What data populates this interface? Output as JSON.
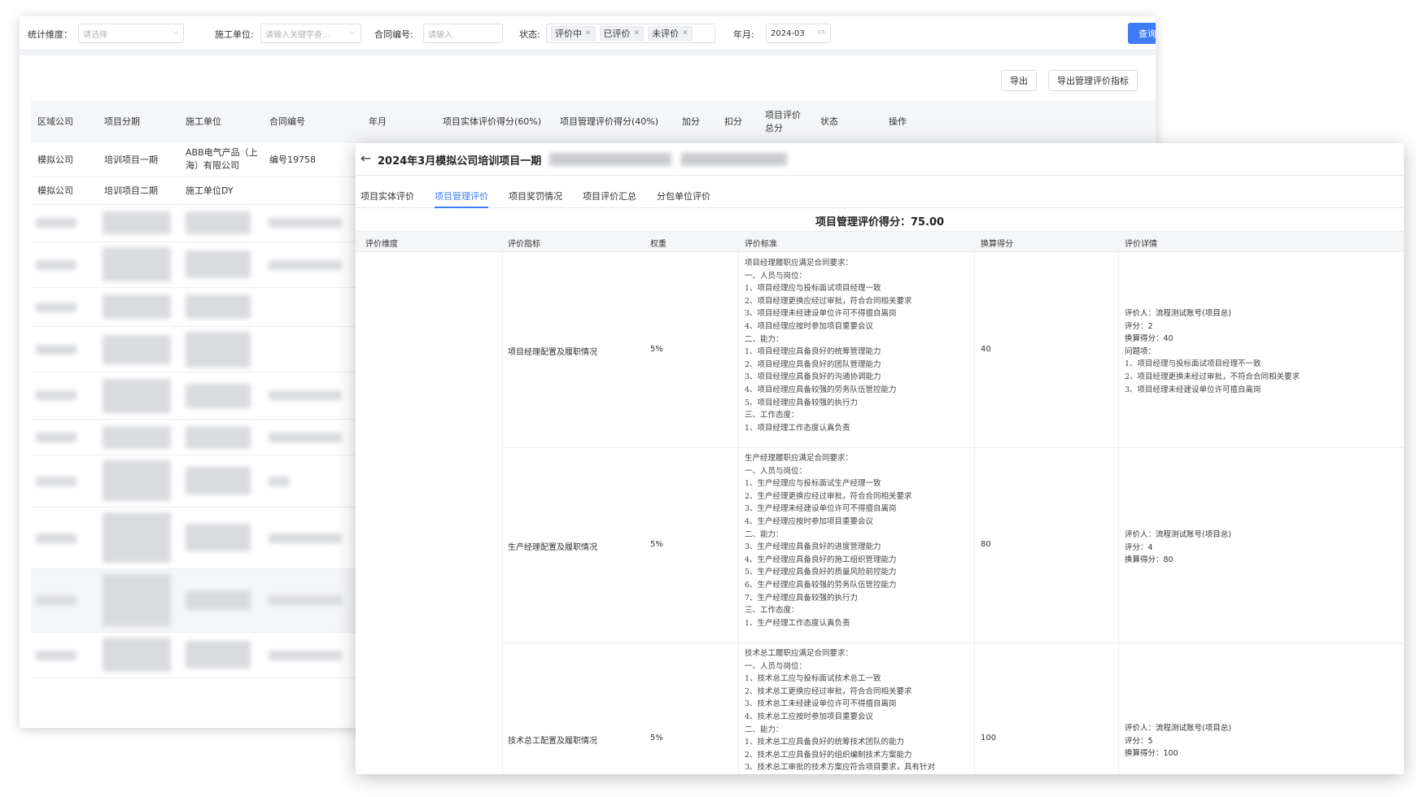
{
  "filter": {
    "dimension_label": "统计维度：",
    "dimension_placeholder": "请选择",
    "unit_label": "施工单位:",
    "unit_placeholder": "请输入关键字查...",
    "contract_label": "合同编号:",
    "contract_placeholder": "请输入",
    "status_label": "状态:",
    "status_tags": [
      "评价中",
      "已评价",
      "未评价"
    ],
    "month_label": "年月:",
    "month_value": "2024-03",
    "search_button": "查询"
  },
  "toolbar": {
    "export_button": "导出",
    "export_index_button": "导出管理评价指标"
  },
  "table": {
    "headers": [
      "区域公司",
      "项目分期",
      "施工单位",
      "合同编号",
      "年月",
      "项目实体评价得分(60%)",
      "项目管理评价得分(40%)",
      "加分",
      "扣分",
      "项目评价总分",
      "状态",
      "操作"
    ],
    "rows": [
      {
        "region": "模拟公司",
        "phase": "培训项目一期",
        "unit": "ABB电气产品（上海）有限公司",
        "contract": "编号19758"
      },
      {
        "region": "模拟公司",
        "phase": "培训项目二期",
        "unit": "施工单位DY",
        "contract": ""
      }
    ]
  },
  "dialog": {
    "title": "2024年3月模拟公司培训项目一期",
    "tabs": [
      "项目实体评价",
      "项目管理评价",
      "项目奖罚情况",
      "项目评价汇总",
      "分包单位评价"
    ],
    "active_tab": 1,
    "score_title": "项目管理评价得分：75.00",
    "headers": [
      "评价维度",
      "评价指标",
      "权重",
      "评价标准",
      "换算得分",
      "评价详情"
    ],
    "rows": [
      {
        "indicator": "项目经理配置及履职情况",
        "weight": "5%",
        "standard": [
          "项目经理履职应满足合同要求：",
          "一、人员与岗位：",
          "1、项目经理应与投标面试项目经理一致",
          "2、项目经理更换应经过审批，符合合同相关要求",
          "3、项目经理未经建设单位许可不得擅自离岗",
          "4、项目经理应按时参加项目重要会议",
          "二、能力：",
          "1、项目经理应具备良好的统筹管理能力",
          "2、项目经理应具备良好的团队管理能力",
          "3、项目经理应具备良好的沟通协调能力",
          "4、项目经理应具备较强的劳务队伍管控能力",
          "5、项目经理应具备较强的执行力",
          "三、工作态度：",
          "1、项目经理工作态度认真负责"
        ],
        "score": "40",
        "details": [
          "评价人：流程测试账号(项目总)",
          "评分：2",
          "换算得分：40"
        ],
        "issues_label": "问题项：",
        "issues": [
          "1、项目经理与投标面试项目经理不一致",
          "2、项目经理更换未经过审批，不符合合同相关要求",
          "3、项目经理未经建设单位许可擅自离岗"
        ]
      },
      {
        "indicator": "生产经理配置及履职情况",
        "weight": "5%",
        "standard": [
          "生产经理履职应满足合同要求：",
          "一、人员与岗位：",
          "1、生产经理应与投标面试生产经理一致",
          "2、生产经理更换应经过审批，符合合同相关要求",
          "3、生产经理未经建设单位许可不得擅自离岗",
          "4、生产经理应按时参加项目重要会议",
          "二、能力：",
          "3、生产经理应具备良好的进度管理能力",
          "4、生产经理应具备良好的施工组织管理能力",
          "5、生产经理应具备良好的质量风险前控能力",
          "6、生产经理应具备较强的劳务队伍管控能力",
          "7、生产经理应具备较强的执行力",
          "三、工作态度：",
          "1、生产经理工作态度认真负责"
        ],
        "score": "80",
        "details": [
          "评价人：流程测试账号(项目总)",
          "评分：4",
          "换算得分：80"
        ]
      },
      {
        "indicator": "技术总工配置及履职情况",
        "weight": "5%",
        "standard": [
          "技术总工履职应满足合同要求：",
          "一、人员与岗位：",
          "1、技术总工应与投标面试技术总工一致",
          "2、技术总工更换应经过审批，符合合同相关要求",
          "3、技术总工未经建设单位许可不得擅自离岗",
          "4、技术总工应按时参加项目重要会议",
          "二、能力：",
          "1、技术总工应具备良好的统筹技术团队的能力",
          "2、技术总工应具备良好的组织编制技术方案能力",
          "3、技术总工审批的技术方案应符合项目要求，具有针对"
        ],
        "score": "100",
        "details": [
          "评价人：流程测试账号(项目总)",
          "评分：5",
          "换算得分：100"
        ]
      }
    ]
  }
}
